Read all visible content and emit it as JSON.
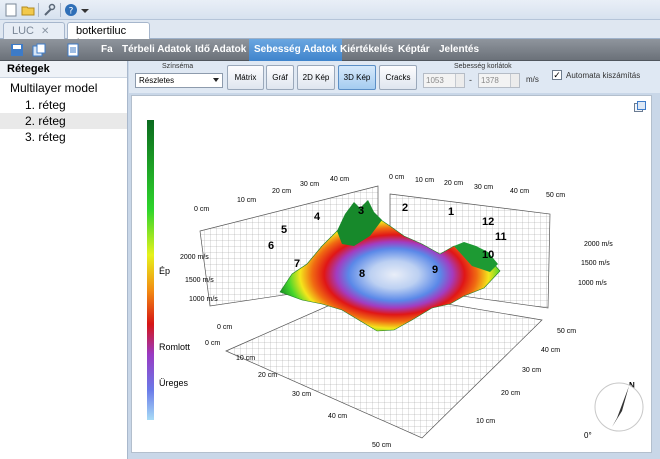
{
  "document_tabs": [
    {
      "label": "LUC",
      "close": "✕"
    },
    {
      "label": "botkertiluc *",
      "close": "✕"
    }
  ],
  "menu": {
    "items": [
      "Fa",
      "Térbeli Adatok",
      "Idő Adatok",
      "Sebesség Adatok",
      "Kiértékelés",
      "Képtár",
      "Jelentés"
    ],
    "active_index": 3,
    "active_color": "#4a8fd4"
  },
  "left_panel": {
    "title": "Rétegek",
    "root": "Multilayer model",
    "items": [
      "1. réteg",
      "2. réteg",
      "3. réteg"
    ],
    "selected_index": 1
  },
  "controls": {
    "color_scheme_label": "Színséma",
    "color_scheme_value": "Részletes",
    "view_buttons": [
      "Mátrix",
      "Gráf",
      "2D Kép",
      "3D Kép",
      "Cracks"
    ],
    "active_view_index": 3,
    "speed_limits_label": "Sebesség korlátok",
    "speed_min": "1053",
    "speed_max": "1378",
    "dash": "-",
    "unit": "m/s",
    "auto_calc_label": "Automata kiszámítás",
    "auto_calc_checked": true,
    "check_mark": "✓"
  },
  "plot": {
    "legend_labels": [
      "Ép",
      "Romlott",
      "Üreges"
    ],
    "left_wall_cm": [
      "0 cm",
      "10 cm",
      "20 cm",
      "30 cm",
      "40 cm"
    ],
    "right_wall_cm": [
      "0 cm",
      "10 cm",
      "20 cm",
      "30 cm",
      "40 cm",
      "50 cm"
    ],
    "left_wall_ms": [
      "2000 m/s",
      "1500 m/s",
      "1000 m/s"
    ],
    "right_wall_ms": [
      "2000 m/s",
      "1500 m/s",
      "1000 m/s"
    ],
    "floor_left_cm": [
      "0 cm",
      "0 cm",
      "10 cm",
      "20 cm",
      "30 cm",
      "40 cm",
      "50 cm"
    ],
    "floor_right_cm": [
      "50 cm",
      "40 cm",
      "30 cm",
      "20 cm",
      "10 cm"
    ],
    "sensor_numbers": [
      "1",
      "2",
      "3",
      "4",
      "5",
      "6",
      "7",
      "8",
      "9",
      "10",
      "11",
      "12"
    ],
    "compass_label": "N",
    "compass_angle": "0°"
  }
}
